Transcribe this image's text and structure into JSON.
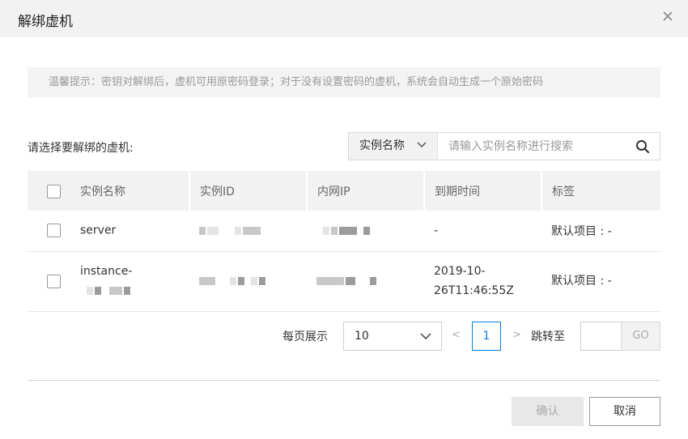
{
  "dialog": {
    "title": "解绑虚机",
    "tip": "温馨提示：密钥对解绑后，虚机可用原密码登录；对于没有设置密码的虚机，系统会自动生成一个原始密码"
  },
  "search": {
    "label": "请选择要解绑的虚机:",
    "field": "实例名称",
    "placeholder": "请输入实例名称进行搜索",
    "value": ""
  },
  "table": {
    "columns": [
      "实例名称",
      "实例ID",
      "内网IP",
      "到期时间",
      "标签"
    ],
    "rows": [
      {
        "name": "server",
        "expire": "-",
        "tag": "默认项目 : -"
      },
      {
        "name_line1": "instance-",
        "expire_line1": "2019-10-",
        "expire_line2": "26T11:46:55Z",
        "tag": "默认项目 : -"
      }
    ]
  },
  "pager": {
    "per_page_label": "每页展示",
    "page_size": "10",
    "prev": "<",
    "current_page": "1",
    "next": ">",
    "jump_label": "跳转至",
    "jump_value": "",
    "go": "GO"
  },
  "footer": {
    "confirm": "确认",
    "cancel": "取消"
  },
  "colors": {
    "accent": "#0a7de6",
    "header_bg": "#f2f2f2"
  },
  "icons": {
    "close": "close-icon",
    "chevron": "chevron-down-icon",
    "search": "search-icon"
  }
}
